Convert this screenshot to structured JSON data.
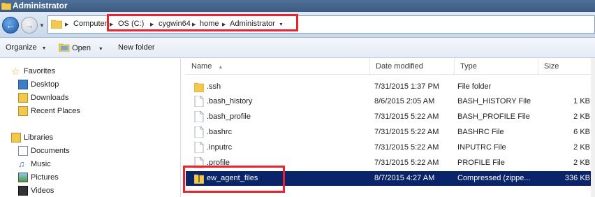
{
  "window": {
    "title": "Administrator"
  },
  "address": {
    "crumbs": [
      "Computer",
      "OS (C:)",
      "cygwin64",
      "home",
      "Administrator"
    ]
  },
  "toolbar": {
    "organize_label": "Organize",
    "open_label": "Open",
    "new_folder_label": "New folder"
  },
  "nav": {
    "favorites_label": "Favorites",
    "favorites": [
      "Desktop",
      "Downloads",
      "Recent Places"
    ],
    "libraries_label": "Libraries",
    "libraries": [
      "Documents",
      "Music",
      "Pictures",
      "Videos"
    ]
  },
  "columns": {
    "name": "Name",
    "date": "Date modified",
    "type": "Type",
    "size": "Size"
  },
  "files": [
    {
      "name": ".ssh",
      "date": "7/31/2015 1:37 PM",
      "type": "File folder",
      "size": "",
      "icon": "folder-icon",
      "selected": false
    },
    {
      "name": ".bash_history",
      "date": "8/6/2015 2:05 AM",
      "type": "BASH_HISTORY File",
      "size": "1 KB",
      "icon": "file-icon",
      "selected": false
    },
    {
      "name": ".bash_profile",
      "date": "7/31/2015 5:22 AM",
      "type": "BASH_PROFILE File",
      "size": "2 KB",
      "icon": "file-icon",
      "selected": false
    },
    {
      "name": ".bashrc",
      "date": "7/31/2015 5:22 AM",
      "type": "BASHRC File",
      "size": "6 KB",
      "icon": "file-icon",
      "selected": false
    },
    {
      "name": ".inputrc",
      "date": "7/31/2015 5:22 AM",
      "type": "INPUTRC File",
      "size": "2 KB",
      "icon": "file-icon",
      "selected": false
    },
    {
      "name": ".profile",
      "date": "7/31/2015 5:22 AM",
      "type": "PROFILE File",
      "size": "2 KB",
      "icon": "file-icon",
      "selected": false
    },
    {
      "name": "ew_agent_files",
      "date": "8/7/2015 4:27 AM",
      "type": "Compressed (zippe...",
      "size": "336 KB",
      "icon": "zip-folder-icon",
      "selected": true
    }
  ],
  "colors": {
    "title_bar": "#3d5b82",
    "selection": "#0a246a",
    "annotation_red": "#e8232e"
  }
}
